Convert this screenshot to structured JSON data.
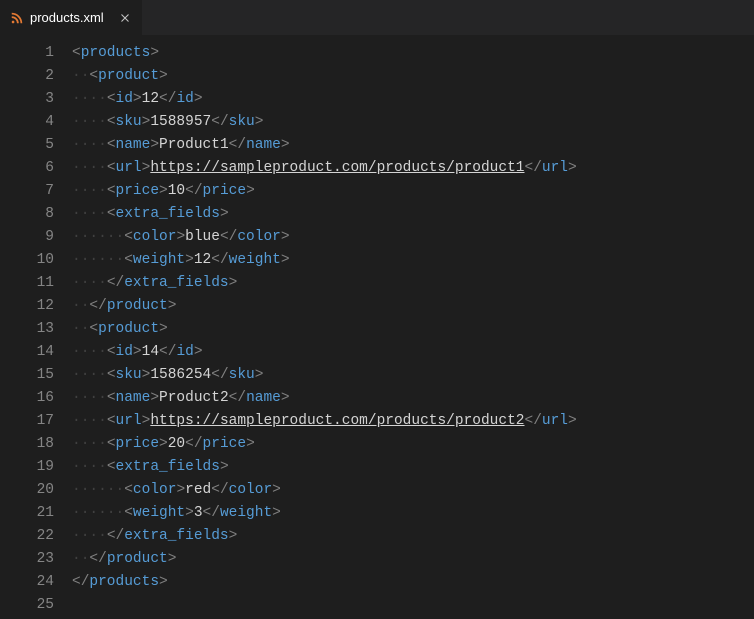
{
  "tab": {
    "filename": "products.xml"
  },
  "code": {
    "lines": [
      {
        "n": 1,
        "indent": 0,
        "segments": [
          {
            "t": "brkt",
            "v": "<"
          },
          {
            "t": "tag",
            "v": "products"
          },
          {
            "t": "brkt",
            "v": ">"
          }
        ]
      },
      {
        "n": 2,
        "indent": 1,
        "segments": [
          {
            "t": "brkt",
            "v": "<"
          },
          {
            "t": "tag",
            "v": "product"
          },
          {
            "t": "brkt",
            "v": ">"
          }
        ]
      },
      {
        "n": 3,
        "indent": 2,
        "segments": [
          {
            "t": "brkt",
            "v": "<"
          },
          {
            "t": "tag",
            "v": "id"
          },
          {
            "t": "brkt",
            "v": ">"
          },
          {
            "t": "txt",
            "v": "12"
          },
          {
            "t": "brkt",
            "v": "</"
          },
          {
            "t": "tag",
            "v": "id"
          },
          {
            "t": "brkt",
            "v": ">"
          }
        ]
      },
      {
        "n": 4,
        "indent": 2,
        "segments": [
          {
            "t": "brkt",
            "v": "<"
          },
          {
            "t": "tag",
            "v": "sku"
          },
          {
            "t": "brkt",
            "v": ">"
          },
          {
            "t": "txt",
            "v": "1588957"
          },
          {
            "t": "brkt",
            "v": "</"
          },
          {
            "t": "tag",
            "v": "sku"
          },
          {
            "t": "brkt",
            "v": ">"
          }
        ]
      },
      {
        "n": 5,
        "indent": 2,
        "segments": [
          {
            "t": "brkt",
            "v": "<"
          },
          {
            "t": "tag",
            "v": "name"
          },
          {
            "t": "brkt",
            "v": ">"
          },
          {
            "t": "txt",
            "v": "Product1"
          },
          {
            "t": "brkt",
            "v": "</"
          },
          {
            "t": "tag",
            "v": "name"
          },
          {
            "t": "brkt",
            "v": ">"
          }
        ]
      },
      {
        "n": 6,
        "indent": 2,
        "segments": [
          {
            "t": "brkt",
            "v": "<"
          },
          {
            "t": "tag",
            "v": "url"
          },
          {
            "t": "brkt",
            "v": ">"
          },
          {
            "t": "url",
            "v": "https://sampleproduct.com/products/product1"
          },
          {
            "t": "brkt",
            "v": "</"
          },
          {
            "t": "tag",
            "v": "url"
          },
          {
            "t": "brkt",
            "v": ">"
          }
        ]
      },
      {
        "n": 7,
        "indent": 2,
        "segments": [
          {
            "t": "brkt",
            "v": "<"
          },
          {
            "t": "tag",
            "v": "price"
          },
          {
            "t": "brkt",
            "v": ">"
          },
          {
            "t": "txt",
            "v": "10"
          },
          {
            "t": "brkt",
            "v": "</"
          },
          {
            "t": "tag",
            "v": "price"
          },
          {
            "t": "brkt",
            "v": ">"
          }
        ]
      },
      {
        "n": 8,
        "indent": 2,
        "segments": [
          {
            "t": "brkt",
            "v": "<"
          },
          {
            "t": "tag",
            "v": "extra_fields"
          },
          {
            "t": "brkt",
            "v": ">"
          }
        ]
      },
      {
        "n": 9,
        "indent": 3,
        "segments": [
          {
            "t": "brkt",
            "v": "<"
          },
          {
            "t": "tag",
            "v": "color"
          },
          {
            "t": "brkt",
            "v": ">"
          },
          {
            "t": "txt",
            "v": "blue"
          },
          {
            "t": "brkt",
            "v": "</"
          },
          {
            "t": "tag",
            "v": "color"
          },
          {
            "t": "brkt",
            "v": ">"
          }
        ]
      },
      {
        "n": 10,
        "indent": 3,
        "segments": [
          {
            "t": "brkt",
            "v": "<"
          },
          {
            "t": "tag",
            "v": "weight"
          },
          {
            "t": "brkt",
            "v": ">"
          },
          {
            "t": "txt",
            "v": "12"
          },
          {
            "t": "brkt",
            "v": "</"
          },
          {
            "t": "tag",
            "v": "weight"
          },
          {
            "t": "brkt",
            "v": ">"
          }
        ]
      },
      {
        "n": 11,
        "indent": 2,
        "segments": [
          {
            "t": "brkt",
            "v": "</"
          },
          {
            "t": "tag",
            "v": "extra_fields"
          },
          {
            "t": "brkt",
            "v": ">"
          }
        ]
      },
      {
        "n": 12,
        "indent": 1,
        "segments": [
          {
            "t": "brkt",
            "v": "</"
          },
          {
            "t": "tag",
            "v": "product"
          },
          {
            "t": "brkt",
            "v": ">"
          }
        ]
      },
      {
        "n": 13,
        "indent": 1,
        "segments": [
          {
            "t": "brkt",
            "v": "<"
          },
          {
            "t": "tag",
            "v": "product"
          },
          {
            "t": "brkt",
            "v": ">"
          }
        ]
      },
      {
        "n": 14,
        "indent": 2,
        "segments": [
          {
            "t": "brkt",
            "v": "<"
          },
          {
            "t": "tag",
            "v": "id"
          },
          {
            "t": "brkt",
            "v": ">"
          },
          {
            "t": "txt",
            "v": "14"
          },
          {
            "t": "brkt",
            "v": "</"
          },
          {
            "t": "tag",
            "v": "id"
          },
          {
            "t": "brkt",
            "v": ">"
          }
        ]
      },
      {
        "n": 15,
        "indent": 2,
        "segments": [
          {
            "t": "brkt",
            "v": "<"
          },
          {
            "t": "tag",
            "v": "sku"
          },
          {
            "t": "brkt",
            "v": ">"
          },
          {
            "t": "txt",
            "v": "1586254"
          },
          {
            "t": "brkt",
            "v": "</"
          },
          {
            "t": "tag",
            "v": "sku"
          },
          {
            "t": "brkt",
            "v": ">"
          }
        ]
      },
      {
        "n": 16,
        "indent": 2,
        "segments": [
          {
            "t": "brkt",
            "v": "<"
          },
          {
            "t": "tag",
            "v": "name"
          },
          {
            "t": "brkt",
            "v": ">"
          },
          {
            "t": "txt",
            "v": "Product2"
          },
          {
            "t": "brkt",
            "v": "</"
          },
          {
            "t": "tag",
            "v": "name"
          },
          {
            "t": "brkt",
            "v": ">"
          }
        ]
      },
      {
        "n": 17,
        "indent": 2,
        "segments": [
          {
            "t": "brkt",
            "v": "<"
          },
          {
            "t": "tag",
            "v": "url"
          },
          {
            "t": "brkt",
            "v": ">"
          },
          {
            "t": "url",
            "v": "https://sampleproduct.com/products/product2"
          },
          {
            "t": "brkt",
            "v": "</"
          },
          {
            "t": "tag",
            "v": "url"
          },
          {
            "t": "brkt",
            "v": ">"
          }
        ]
      },
      {
        "n": 18,
        "indent": 2,
        "segments": [
          {
            "t": "brkt",
            "v": "<"
          },
          {
            "t": "tag",
            "v": "price"
          },
          {
            "t": "brkt",
            "v": ">"
          },
          {
            "t": "txt",
            "v": "20"
          },
          {
            "t": "brkt",
            "v": "</"
          },
          {
            "t": "tag",
            "v": "price"
          },
          {
            "t": "brkt",
            "v": ">"
          }
        ]
      },
      {
        "n": 19,
        "indent": 2,
        "segments": [
          {
            "t": "brkt",
            "v": "<"
          },
          {
            "t": "tag",
            "v": "extra_fields"
          },
          {
            "t": "brkt",
            "v": ">"
          }
        ]
      },
      {
        "n": 20,
        "indent": 3,
        "segments": [
          {
            "t": "brkt",
            "v": "<"
          },
          {
            "t": "tag",
            "v": "color"
          },
          {
            "t": "brkt",
            "v": ">"
          },
          {
            "t": "txt",
            "v": "red"
          },
          {
            "t": "brkt",
            "v": "</"
          },
          {
            "t": "tag",
            "v": "color"
          },
          {
            "t": "brkt",
            "v": ">"
          }
        ]
      },
      {
        "n": 21,
        "indent": 3,
        "segments": [
          {
            "t": "brkt",
            "v": "<"
          },
          {
            "t": "tag",
            "v": "weight"
          },
          {
            "t": "brkt",
            "v": ">"
          },
          {
            "t": "txt",
            "v": "3"
          },
          {
            "t": "brkt",
            "v": "</"
          },
          {
            "t": "tag",
            "v": "weight"
          },
          {
            "t": "brkt",
            "v": ">"
          }
        ]
      },
      {
        "n": 22,
        "indent": 2,
        "segments": [
          {
            "t": "brkt",
            "v": "</"
          },
          {
            "t": "tag",
            "v": "extra_fields"
          },
          {
            "t": "brkt",
            "v": ">"
          }
        ]
      },
      {
        "n": 23,
        "indent": 1,
        "segments": [
          {
            "t": "brkt",
            "v": "</"
          },
          {
            "t": "tag",
            "v": "product"
          },
          {
            "t": "brkt",
            "v": ">"
          }
        ]
      },
      {
        "n": 24,
        "indent": 0,
        "segments": [
          {
            "t": "brkt",
            "v": "</"
          },
          {
            "t": "tag",
            "v": "products"
          },
          {
            "t": "brkt",
            "v": ">"
          }
        ]
      },
      {
        "n": 25,
        "indent": 0,
        "segments": []
      }
    ]
  }
}
